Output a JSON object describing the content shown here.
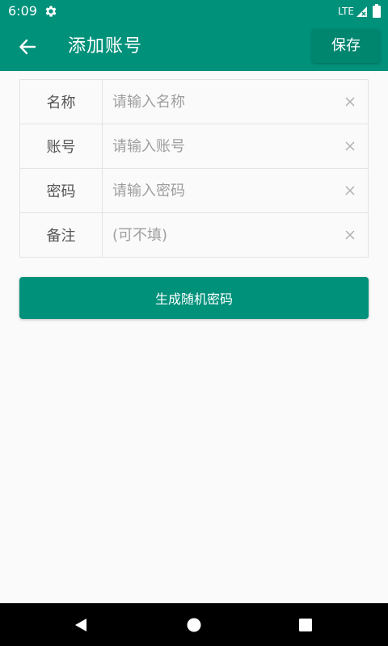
{
  "status_bar": {
    "time": "6:09",
    "network": "LTE",
    "icons": [
      "gear-icon",
      "signal-icon",
      "battery-icon"
    ]
  },
  "app_bar": {
    "title": "添加账号",
    "save_label": "保存",
    "back_icon": "arrow-left-icon"
  },
  "form": {
    "rows": [
      {
        "label": "名称",
        "value": "",
        "placeholder": "请输入名称"
      },
      {
        "label": "账号",
        "value": "",
        "placeholder": "请输入账号"
      },
      {
        "label": "密码",
        "value": "",
        "placeholder": "请输入密码"
      },
      {
        "label": "备注",
        "value": "",
        "placeholder": "(可不填)"
      }
    ],
    "clear_icon": "close-icon"
  },
  "generate_button_label": "生成随机密码",
  "nav_bar": {
    "icons": [
      "nav-back-icon",
      "nav-home-icon",
      "nav-recent-icon"
    ]
  },
  "colors": {
    "primary": "#00917b",
    "background": "#fafafa",
    "divider": "#e3e3e3"
  }
}
